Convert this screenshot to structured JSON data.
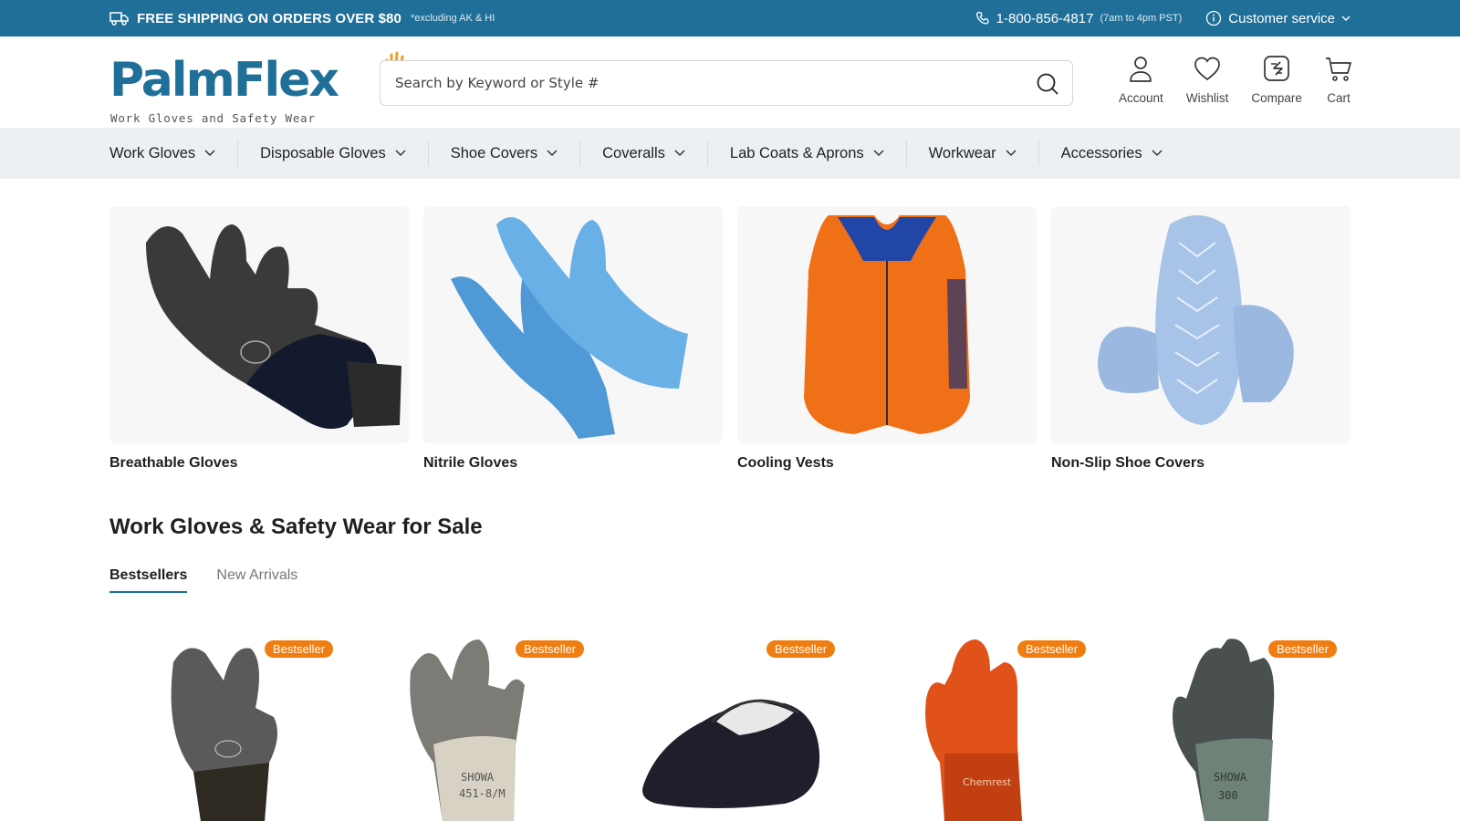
{
  "topbar": {
    "shipping_text": "FREE SHIPPING  ON ORDERS  OVER $80",
    "shipping_note": "*excluding AK & HI",
    "phone": "1-800-856-4817",
    "phone_hours": "(7am to 4pm PST)",
    "customer_service": "Customer service",
    "icons": [
      "truck-icon",
      "phone-icon",
      "info-icon",
      "chevron-down-icon"
    ]
  },
  "header": {
    "logo_part1": "Palm",
    "logo_part2": "Flex",
    "logo_tagline": "Work Gloves and Safety Wear",
    "search_placeholder": "Search by Keyword or Style #",
    "icons": [
      {
        "label": "Account",
        "icon": "user-icon"
      },
      {
        "label": "Wishlist",
        "icon": "heart-icon"
      },
      {
        "label": "Compare",
        "icon": "compare-icon"
      },
      {
        "label": "Cart",
        "icon": "cart-icon"
      }
    ]
  },
  "nav": {
    "items": [
      "Work Gloves",
      "Disposable Gloves",
      "Shoe Covers",
      "Coveralls",
      "Lab Coats & Aprons",
      "Workwear",
      "Accessories"
    ]
  },
  "categories": [
    {
      "label": "Breathable Gloves",
      "image": "black-glove"
    },
    {
      "label": "Nitrile Gloves",
      "image": "blue-nitrile-gloves"
    },
    {
      "label": "Cooling Vests",
      "image": "orange-vest"
    },
    {
      "label": "Non-Slip Shoe Covers",
      "image": "blue-shoe-covers"
    }
  ],
  "section": {
    "title": "Work Gloves & Safety Wear for Sale",
    "tabs": [
      {
        "label": "Bestsellers",
        "active": true
      },
      {
        "label": "New Arrivals",
        "active": false
      }
    ]
  },
  "products": [
    {
      "badge": "Bestseller",
      "image": "black-gray-glove"
    },
    {
      "badge": "Bestseller",
      "image": "gray-white-glove"
    },
    {
      "badge": "Bestseller",
      "image": "black-shoe-cover"
    },
    {
      "badge": "Bestseller",
      "image": "orange-pvc-glove"
    },
    {
      "badge": "Bestseller",
      "image": "gray-green-glove"
    }
  ],
  "colors": {
    "brand_blue": "#1f6f99",
    "accent_orange": "#f07d10",
    "nav_bg": "#edf0f3"
  }
}
